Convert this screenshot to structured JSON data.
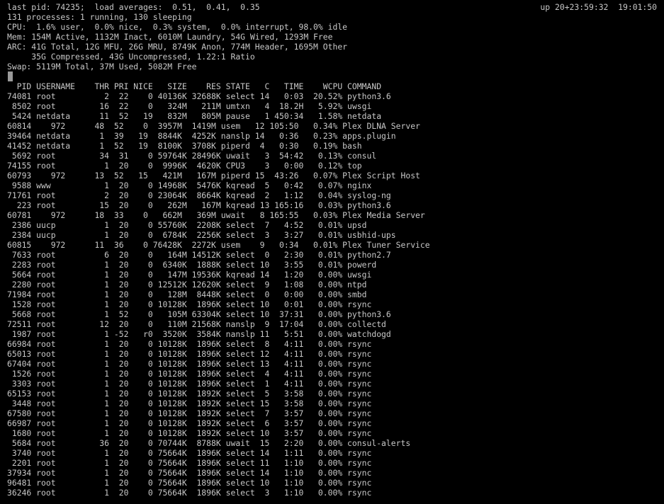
{
  "colors": {
    "background": "#000000",
    "text": "#c7c7c7",
    "cursor": "#9a9a9a"
  },
  "header": {
    "last_pid_line": "last pid: 74235;  load averages:  0.51,  0.41,  0.35",
    "uptime_clock": "up 20+23:59:32  19:01:50",
    "processes_line": "131 processes: 1 running, 130 sleeping",
    "cpu_line": "CPU:  1.6% user,  0.0% nice,  0.3% system,  0.0% interrupt, 98.0% idle",
    "mem_line": "Mem: 154M Active, 1132M Inact, 6010M Laundry, 54G Wired, 1293M Free",
    "arc_line": "ARC: 41G Total, 12G MFU, 26G MRU, 8749K Anon, 774M Header, 1695M Other",
    "arc_line2": "     35G Compressed, 43G Uncompressed, 1.22:1 Ratio",
    "swap_line": "Swap: 5119M Total, 37M Used, 5082M Free"
  },
  "table": {
    "header": "  PID USERNAME    THR PRI NICE   SIZE    RES STATE   C   TIME    WCPU COMMAND",
    "rows": [
      "74081 root          2  22    0 40136K 32688K select 14   0:03  20.52% python3.6",
      " 8502 root         16  22    0   324M   211M umtxn   4  18.2H   5.92% uwsgi",
      " 5424 netdata      11  52   19   832M   805M pause   1 450:34   1.58% netdata",
      "60814    972      48  52    0  3957M  1419M usem   12 105:50   0.34% Plex DLNA Server",
      "39464 netdata      1  39   19  8844K  4252K nanslp 14   0:36   0.23% apps.plugin",
      "41452 netdata      1  52   19  8100K  3708K piperd  4   0:30   0.19% bash",
      " 5692 root         34  31    0 59764K 28496K uwait   3  54:42   0.13% consul",
      "74155 root          1  20    0  9996K  4620K CPU3    3   0:00   0.12% top",
      "60793    972      13  52   15   421M   167M piperd 15  43:26   0.07% Plex Script Host",
      " 9588 www           1  20    0 14968K  5476K kqread  5   0:42   0.07% nginx",
      "71761 root          2  20    0 23064K  8664K kqread  2   1:12   0.04% syslog-ng",
      "  223 root         15  20    0   262M   167M kqread 13 165:16   0.03% python3.6",
      "60781    972      18  33    0   662M   369M uwait   8 165:55   0.03% Plex Media Server",
      " 2386 uucp          1  20    0 55760K  2208K select  7   4:52   0.01% upsd",
      " 2384 uucp          1  20    0  6784K  2256K select  3   3:27   0.01% usbhid-ups",
      "60815    972      11  36    0 76428K  2272K usem    9   0:34   0.01% Plex Tuner Service",
      " 7633 root          6  20    0   164M 14512K select  0   2:30   0.01% python2.7",
      " 2283 root          1  20    0  6340K  1888K select 10   3:55   0.01% powerd",
      " 5664 root          1  20    0   147M 19536K kqread 14   1:20   0.00% uwsgi",
      " 2280 root          1  20    0 12512K 12620K select  9   1:08   0.00% ntpd",
      "71984 root          1  20    0   128M  8448K select  0   0:00   0.00% smbd",
      " 1528 root          1  20    0 10128K  1896K select 10   0:01   0.00% rsync",
      " 5668 root          1  52    0   105M 63304K select 10  37:31   0.00% python3.6",
      "72511 root         12  20    0   110M 21568K nanslp  9  17:04   0.00% collectd",
      " 1987 root          1 -52   r0  3520K  3584K nanslp 11   5:51   0.00% watchdogd",
      "66984 root          1  20    0 10128K  1896K select  8   4:11   0.00% rsync",
      "65013 root          1  20    0 10128K  1896K select 12   4:11   0.00% rsync",
      "67404 root          1  20    0 10128K  1896K select 13   4:11   0.00% rsync",
      " 1526 root          1  20    0 10128K  1896K select  4   4:11   0.00% rsync",
      " 3303 root          1  20    0 10128K  1896K select  1   4:11   0.00% rsync",
      "65153 root          1  20    0 10128K  1892K select  5   3:58   0.00% rsync",
      " 3448 root          1  20    0 10128K  1892K select 15   3:58   0.00% rsync",
      "67580 root          1  20    0 10128K  1892K select  7   3:57   0.00% rsync",
      "66987 root          1  20    0 10128K  1892K select  6   3:57   0.00% rsync",
      " 1680 root          1  20    0 10128K  1892K select 10   3:57   0.00% rsync",
      " 5684 root         36  20    0 70744K  8788K uwait  15   2:20   0.00% consul-alerts",
      " 3740 root          1  20    0 75664K  1896K select 14   1:11   0.00% rsync",
      " 2201 root          1  20    0 75664K  1896K select 11   1:10   0.00% rsync",
      "37934 root          1  20    0 75664K  1896K select 14   1:10   0.00% rsync",
      "96481 root          1  20    0 75664K  1896K select 10   1:10   0.00% rsync",
      "36246 root          1  20    0 75664K  1896K select  3   1:10   0.00% rsync"
    ]
  }
}
